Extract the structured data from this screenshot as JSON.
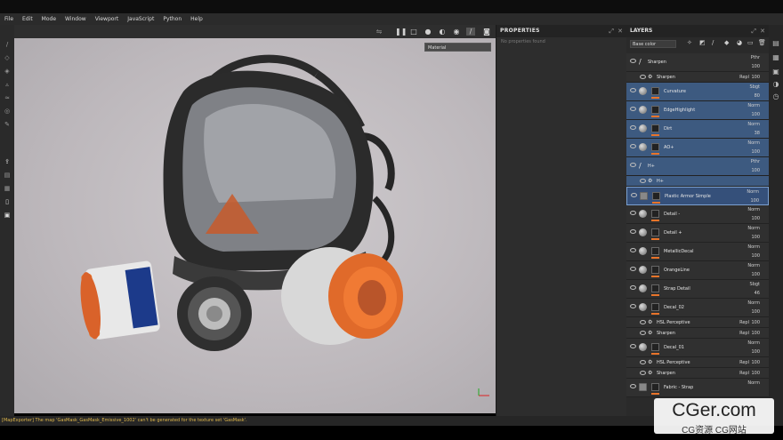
{
  "menu": [
    "File",
    "Edit",
    "Mode",
    "Window",
    "Viewport",
    "JavaScript",
    "Python",
    "Help"
  ],
  "viewport": {
    "material_dropdown": "Material"
  },
  "properties": {
    "title": "PROPERTIES",
    "empty": "No properties found"
  },
  "layers": {
    "title": "LAYERS",
    "channel": "Base color",
    "rows": [
      {
        "name": "Sharpen",
        "blend": "Pthr",
        "opacity": "100",
        "kind": "brush"
      },
      {
        "name": "Sharpen",
        "blend": "Repl",
        "opacity": "100",
        "kind": "sub"
      },
      {
        "name": "Curvature",
        "blend": "Sbgt",
        "opacity": "80",
        "kind": "fill"
      },
      {
        "name": "EdgeHighlight",
        "blend": "Norm",
        "opacity": "100",
        "kind": "fill"
      },
      {
        "name": "Dirt",
        "blend": "Norm",
        "opacity": "38",
        "kind": "fill"
      },
      {
        "name": "AO+",
        "blend": "Norm",
        "opacity": "100",
        "kind": "fill"
      },
      {
        "name": "H+",
        "blend": "Pthr",
        "opacity": "100",
        "kind": "brush"
      },
      {
        "name": "H+",
        "blend": "",
        "opacity": "",
        "kind": "sub"
      },
      {
        "name": "Plastic Armor Simple",
        "blend": "Norm",
        "opacity": "100",
        "kind": "folder"
      },
      {
        "name": "Detail -",
        "blend": "Norm",
        "opacity": "100",
        "kind": "fill"
      },
      {
        "name": "Detail +",
        "blend": "Norm",
        "opacity": "100",
        "kind": "fill"
      },
      {
        "name": "MetallicDecal",
        "blend": "Norm",
        "opacity": "100",
        "kind": "fill"
      },
      {
        "name": "OrangeLine",
        "blend": "Norm",
        "opacity": "100",
        "kind": "fill"
      },
      {
        "name": "Strap Detail",
        "blend": "Sbgt",
        "opacity": "46",
        "kind": "fill"
      },
      {
        "name": "Decal_02",
        "blend": "Norm",
        "opacity": "100",
        "kind": "fill"
      },
      {
        "name": "HSL Perceptive",
        "blend": "Repl",
        "opacity": "100",
        "kind": "sub"
      },
      {
        "name": "Sharpen",
        "blend": "Repl",
        "opacity": "100",
        "kind": "sub"
      },
      {
        "name": "Decal_01",
        "blend": "Norm",
        "opacity": "100",
        "kind": "fill"
      },
      {
        "name": "HSL Perceptive",
        "blend": "Repl",
        "opacity": "100",
        "kind": "sub"
      },
      {
        "name": "Sharpen",
        "blend": "Repl",
        "opacity": "100",
        "kind": "sub"
      },
      {
        "name": "Fabric - Strap",
        "blend": "Norm",
        "opacity": "",
        "kind": "folder"
      }
    ]
  },
  "status": "[MapExporter] The map 'GasMask_GasMask_Emissive_1002' can't be generated for the texture set 'GasMask'.",
  "watermark": {
    "line1": "CGer.com",
    "line2": "CG资源 CG网站"
  },
  "colors": {
    "accent": "#e8742a",
    "selection": "#3d5a80"
  }
}
